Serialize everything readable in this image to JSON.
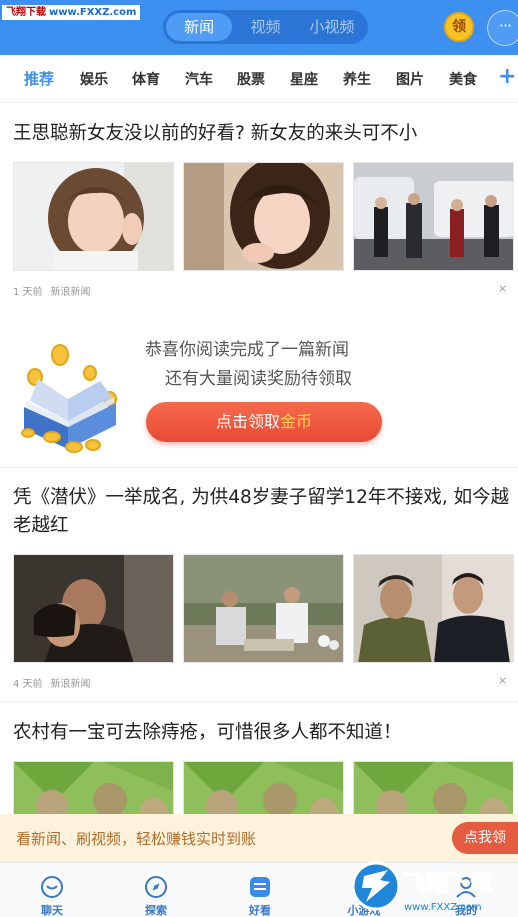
{
  "watermark": {
    "site": "飞翔下载",
    "url": "www.FXXZ.com"
  },
  "header": {
    "tabs": [
      {
        "label": "新闻"
      },
      {
        "label": "视频"
      },
      {
        "label": "小视频"
      }
    ],
    "coin_button": "领",
    "more_button": "···"
  },
  "categories": {
    "items": [
      {
        "label": "推荐"
      },
      {
        "label": "娱乐"
      },
      {
        "label": "体育"
      },
      {
        "label": "汽车"
      },
      {
        "label": "股票"
      },
      {
        "label": "星座"
      },
      {
        "label": "养生"
      },
      {
        "label": "图片"
      },
      {
        "label": "美食"
      }
    ],
    "add_icon": "plus-icon"
  },
  "articles": [
    {
      "title": "王思聪新女友没以前的好看? 新女友的来头可不小",
      "time": "1 天前",
      "source": "新浪新闻",
      "close": "×"
    },
    {
      "title": "凭《潜伏》一举成名, 为供48岁妻子留学12年不接戏, 如今越老越红",
      "time": "4 天前",
      "source": "新浪新闻",
      "close": "×"
    },
    {
      "title": "农村有一宝可去除痔疮，可惜很多人都不知道！"
    }
  ],
  "reward": {
    "line1": "恭喜你阅读完成了一篇新闻",
    "line2": "还有大量阅读奖励待领取",
    "cta_prefix": "点击领取",
    "cta_highlight": "金币"
  },
  "banner": {
    "text": "看新闻、刷视频，轻松赚钱实时到账",
    "button": "点我领"
  },
  "bottom_nav": [
    {
      "label": "聊天",
      "icon": "chat-icon"
    },
    {
      "label": "探索",
      "icon": "compass-icon"
    },
    {
      "label": "好看",
      "icon": "news-icon"
    },
    {
      "label": "小游戏",
      "icon": "game-icon"
    },
    {
      "label": "我的",
      "icon": "profile-icon"
    }
  ],
  "corner_watermark": {
    "text": "飞翔下载",
    "url": "www.FXXZ.com"
  },
  "colors": {
    "brand_blue": "#3d8ff0",
    "cta_red": "#e84a35",
    "coin_gold": "#f6c226",
    "banner_bg": "#fdf3dc"
  }
}
